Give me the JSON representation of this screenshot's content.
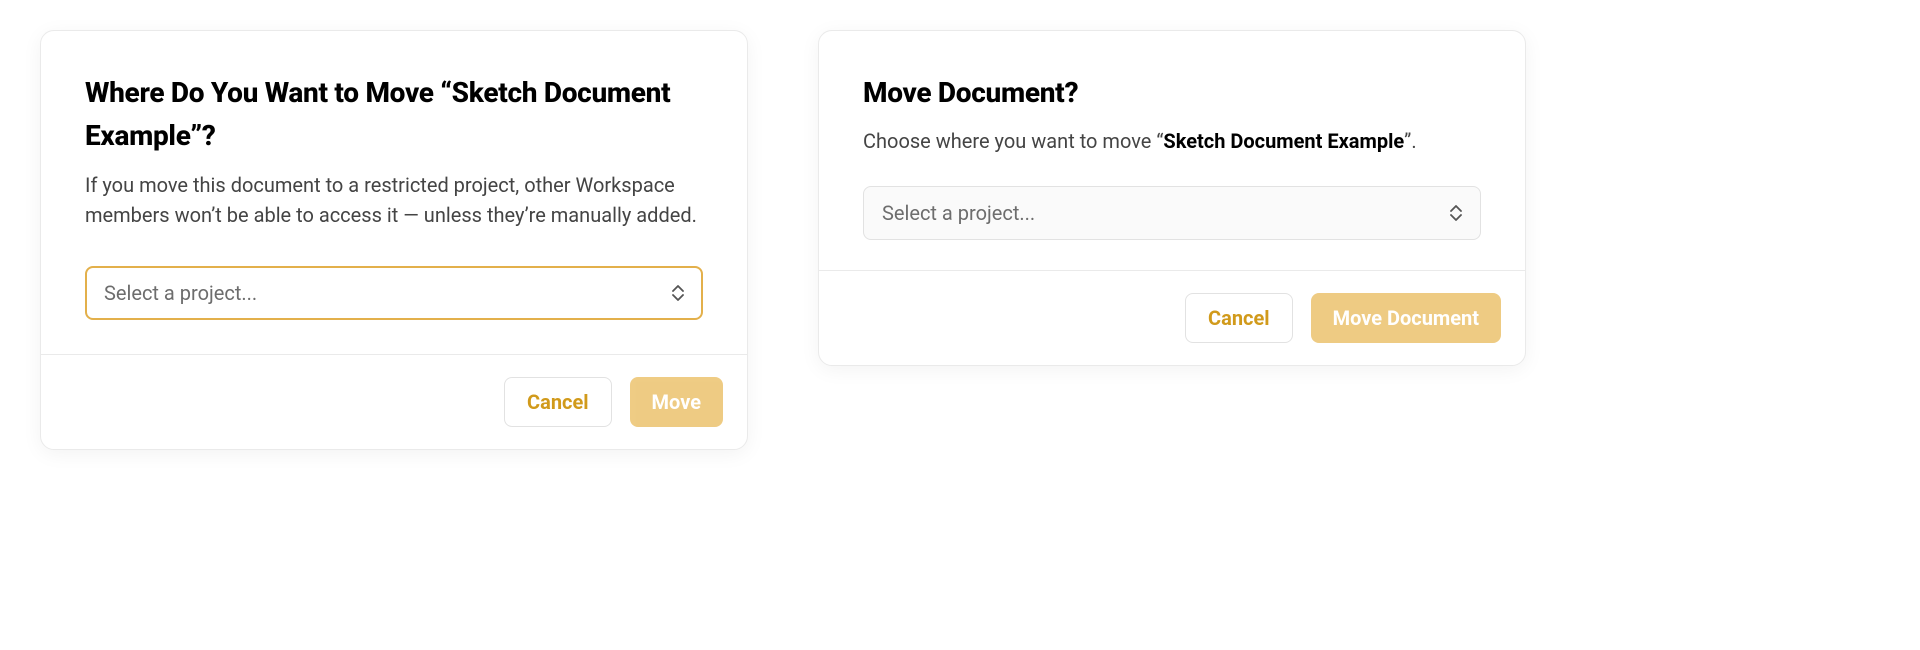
{
  "left_modal": {
    "title": "Where Do You Want to Move “Sketch Document Example”?",
    "description": "If you move this document to a restricted project, other Workspace members won’t be able to access it — unless they’re manually added.",
    "select_placeholder": "Select a project...",
    "cancel_label": "Cancel",
    "primary_label": "Move"
  },
  "right_modal": {
    "title": "Move Document?",
    "description_prefix": "Choose where you want to move “",
    "description_doc": "Sketch Document Example",
    "description_suffix": "”.",
    "select_placeholder": "Select a project...",
    "cancel_label": "Cancel",
    "primary_label": "Move Document"
  }
}
